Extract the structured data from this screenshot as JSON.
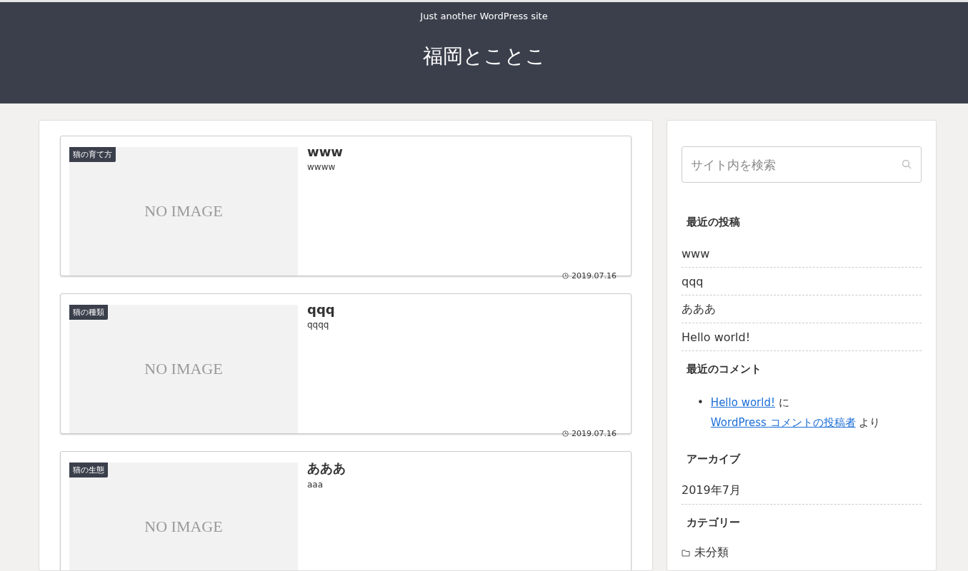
{
  "header": {
    "tagline": "Just another WordPress site",
    "site_title": "福岡とことこ"
  },
  "posts": [
    {
      "category": "猫の育て方",
      "image_text": "NO IMAGE",
      "title": "www",
      "excerpt": "wwww",
      "date": "2019.07.16"
    },
    {
      "category": "猫の種類",
      "image_text": "NO IMAGE",
      "title": "qqq",
      "excerpt": "qqqq",
      "date": "2019.07.16"
    },
    {
      "category": "猫の生態",
      "image_text": "NO IMAGE",
      "title": "あああ",
      "excerpt": "aaa"
    }
  ],
  "sidebar": {
    "search": {
      "placeholder": "サイト内を検索"
    },
    "recent_posts": {
      "heading": "最近の投稿",
      "items": [
        "www",
        "qqq",
        "あああ",
        "Hello world!"
      ]
    },
    "recent_comments": {
      "heading": "最近のコメント",
      "items": [
        {
          "marker": "•",
          "post_link": "Hello world!",
          "joiner": "に",
          "author_link": "WordPress コメントの投稿者",
          "suffix": "より"
        }
      ]
    },
    "archives": {
      "heading": "アーカイブ",
      "items": [
        "2019年7月"
      ]
    },
    "categories": {
      "heading": "カテゴリー",
      "items": [
        "未分類"
      ]
    }
  }
}
